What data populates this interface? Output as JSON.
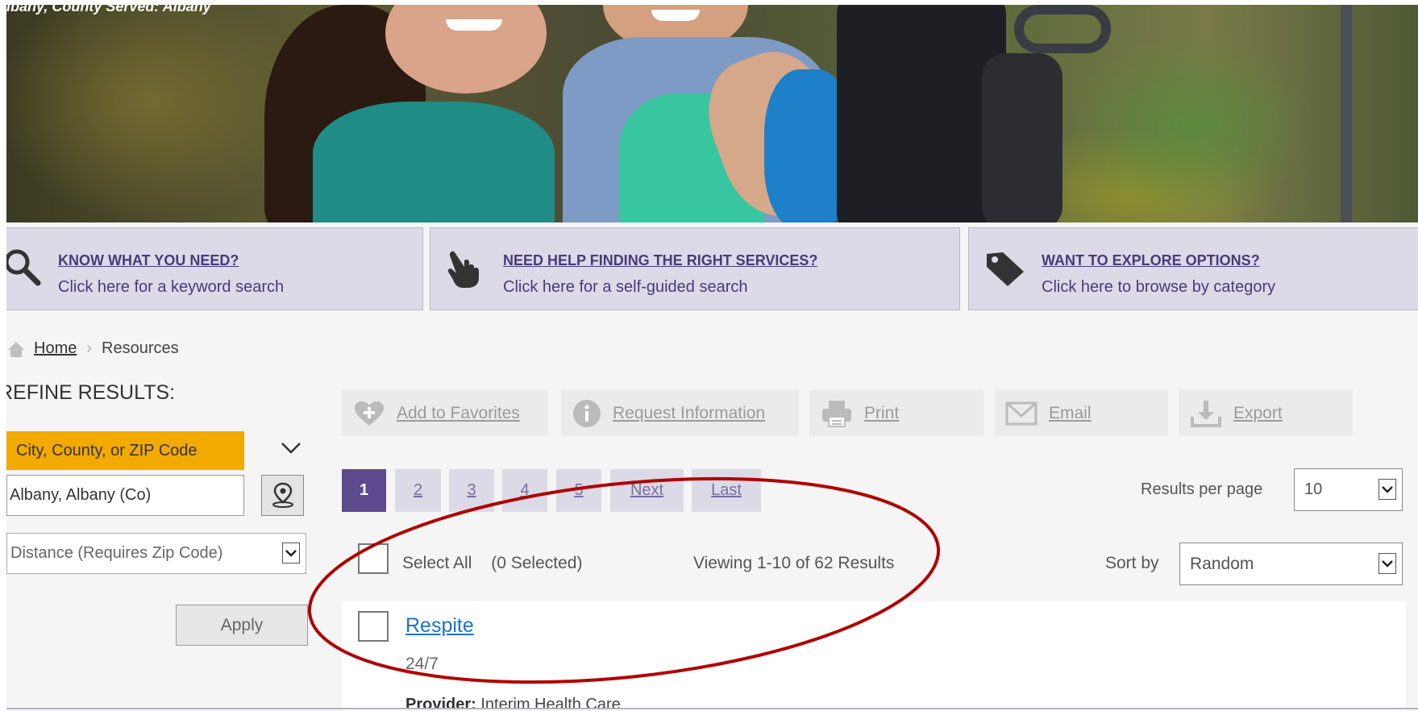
{
  "hero": {
    "caption": "lbany, County Served: Albany"
  },
  "search_options": [
    {
      "title": "KNOW WHAT YOU NEED?",
      "subtitle": "Click here for a keyword search",
      "icon": "magnifier-icon"
    },
    {
      "title": "NEED HELP FINDING THE RIGHT SERVICES?",
      "subtitle": "Click here for a self-guided search",
      "icon": "pointing-hand-icon"
    },
    {
      "title": "WANT TO EXPLORE OPTIONS?",
      "subtitle": "Click here to browse by category",
      "icon": "tag-icon"
    }
  ],
  "breadcrumb": {
    "home": "Home",
    "current": "Resources"
  },
  "refine": {
    "heading": "REFINE RESULTS:",
    "location_tab": "City, County, or ZIP Code",
    "location_value": "Albany, Albany (Co)",
    "distance_placeholder": "Distance (Requires Zip Code)",
    "apply_label": "Apply"
  },
  "actions": [
    {
      "label": "Add to Favorites",
      "icon": "heart-plus-icon"
    },
    {
      "label": "Request Information",
      "icon": "info-icon"
    },
    {
      "label": "Print",
      "icon": "printer-icon"
    },
    {
      "label": "Email",
      "icon": "envelope-icon"
    },
    {
      "label": "Export",
      "icon": "download-icon"
    }
  ],
  "pagination": {
    "pages": [
      "1",
      "2",
      "3",
      "4",
      "5"
    ],
    "next": "Next",
    "last": "Last",
    "current": "1"
  },
  "results_per_page": {
    "label": "Results per page",
    "value": "10"
  },
  "selection": {
    "select_all": "Select All",
    "selected_count": "(0 Selected)"
  },
  "viewing_text": "Viewing 1-10 of 62 Results",
  "sort": {
    "label": "Sort by",
    "value": "Random"
  },
  "results": [
    {
      "title": "Respite",
      "hours": "24/7",
      "provider_label": "Provider:",
      "provider": "Interim Health Care"
    }
  ],
  "colors": {
    "accent_purple": "#5d4a8e",
    "option_bg": "#dcdae6",
    "location_tab": "#f2a900",
    "link_blue": "#1a73c9",
    "annotation_red": "#b00000"
  }
}
